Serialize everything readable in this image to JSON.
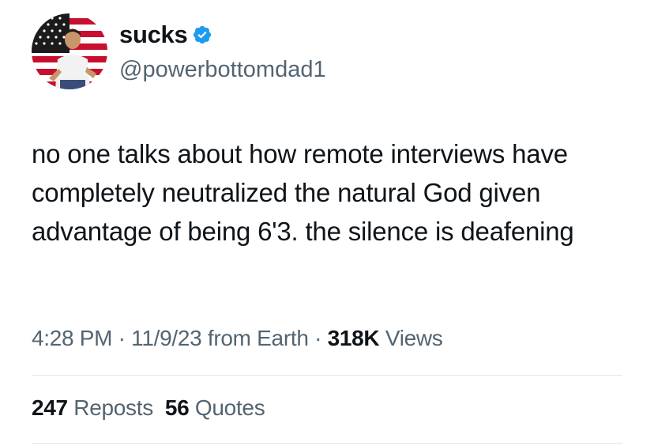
{
  "author": {
    "display_name": "sucks",
    "handle": "@powerbottomdad1",
    "verified_badge_icon": "verified-badge-icon",
    "avatar_icon": "avatar-flag-photo"
  },
  "tweet": {
    "text": "no one talks about how remote interviews have completely neutralized the natural God given advantage of being 6'3. the silence is deafening"
  },
  "meta": {
    "time": "4:28 PM",
    "sep1": " · ",
    "date": "11/9/23",
    "source": " from Earth",
    "sep2": " · ",
    "views_count": "318K",
    "views_label": " Views"
  },
  "stats": {
    "reposts_count": "247",
    "reposts_label": " Reposts",
    "quotes_count": "56",
    "quotes_label": " Quotes"
  },
  "colors": {
    "text": "#0f1419",
    "secondary": "#536471",
    "verified_blue": "#1d9bf0"
  }
}
